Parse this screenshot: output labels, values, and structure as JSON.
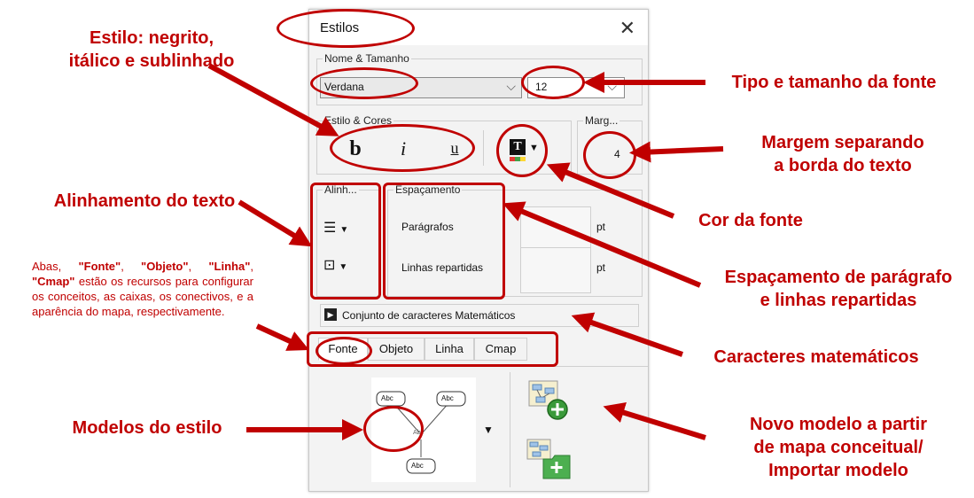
{
  "panel": {
    "title": "Estilos",
    "close_glyph": "✕",
    "font_group": {
      "legend": "Nome & Tamanho",
      "font_name": "Verdana",
      "font_size": "12"
    },
    "style_group": {
      "legend": "Estilo & Cores",
      "bold_label": "b",
      "italic_label": "i",
      "underline_label": "u",
      "color_icon_letter": "T"
    },
    "margin_group": {
      "legend": "Marg...",
      "value": "4"
    },
    "align_group": {
      "legend": "Alinh..."
    },
    "spacing_group": {
      "legend": "Espaçamento",
      "paragraphs_label": "Parágrafos",
      "lines_label": "Linhas repartidas",
      "unit": "pt"
    },
    "charset_label": "Conjunto de caracteres Matemáticos",
    "tabs": [
      {
        "label": "Fonte",
        "active": true
      },
      {
        "label": "Objeto",
        "active": false
      },
      {
        "label": "Linha",
        "active": false
      },
      {
        "label": "Cmap",
        "active": false
      }
    ],
    "preview": {
      "node_label": "Abc"
    }
  },
  "annotations": {
    "estilo": "Estilo: negrito, itálico e sublinhado",
    "estilo_line1": "Estilo: negrito,",
    "estilo_line2": "itálico e sublinhado",
    "alinhamento": "Alinhamento do texto",
    "modelos": "Modelos do estilo",
    "tipo": "Tipo e tamanho da fonte",
    "margem_line1": "Margem separando",
    "margem_line2": "a borda do texto",
    "cor": "Cor da fonte",
    "espacamento_line1": "Espaçamento de parágrafo",
    "espacamento_line2": "e linhas repartidas",
    "caracteres": "Caracteres matemáticos",
    "novo_line1": "Novo modelo a partir",
    "novo_line2": "de mapa conceitual/",
    "novo_line3": "Importar modelo",
    "note_part1": "Abas, ",
    "note_fonte": "\"Fonte\"",
    "note_sep1": ", ",
    "note_objeto": "\"Objeto\"",
    "note_sep2": ", ",
    "note_linha": "\"Linha\"",
    "note_sep3": ", ",
    "note_cmap": "\"Cmap\"",
    "note_part2": " estão os recursos para configurar os conceitos, as caixas, os conectivos, e a aparência do mapa, respectivamente."
  },
  "colors": {
    "annotation": "#c00000",
    "panel_bg": "#f3f3f3"
  }
}
